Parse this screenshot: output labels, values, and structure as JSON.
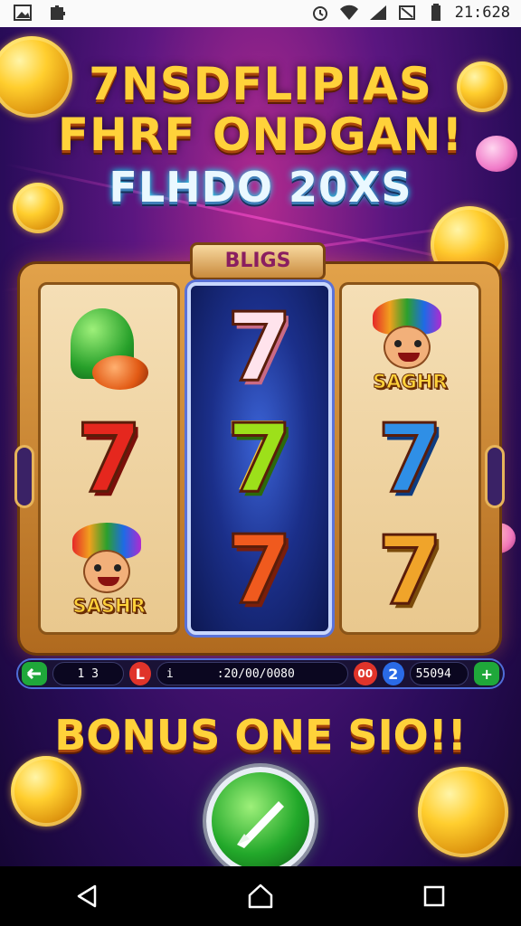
{
  "status_bar": {
    "time": "21:628",
    "icons": [
      "image-icon",
      "puzzle-icon",
      "alarm-icon",
      "wifi-icon",
      "signal-icon",
      "data-off-icon",
      "battery-icon"
    ]
  },
  "game": {
    "title_line1": "7NSDFLIPIAS",
    "title_line2": "FHRF ONDGAN!",
    "title_line3": "FLHDO 20XS",
    "reel_plaque": "BLIGS",
    "reels": [
      {
        "symbols": [
          "green-hat",
          "red-seven",
          "jester-character"
        ],
        "character_label": "SASHR"
      },
      {
        "symbols": [
          "pink-seven",
          "rainbow-seven",
          "tilted-seven"
        ]
      },
      {
        "symbols": [
          "jester-character",
          "blue-seven",
          "gold-seven"
        ],
        "character_label": "SAGHR"
      }
    ],
    "control_bar": {
      "left_button": "minus-icon",
      "bet_value": "1 3",
      "bet_button": "L",
      "center_mark": "i",
      "credit_value": ":20/00/0080",
      "right_label": "00",
      "info_button": "2",
      "win_value": "55094",
      "plus_button": "+"
    },
    "bonus_text": "BONUS ONE SIO!!",
    "spin_button": "spin-icon",
    "colors": {
      "accent_gold": "#ffd23a",
      "background": "#5a1680",
      "spin_green": "#22a82a"
    }
  },
  "nav_bar": {
    "buttons": [
      "back-icon",
      "home-icon",
      "recents-icon"
    ]
  }
}
